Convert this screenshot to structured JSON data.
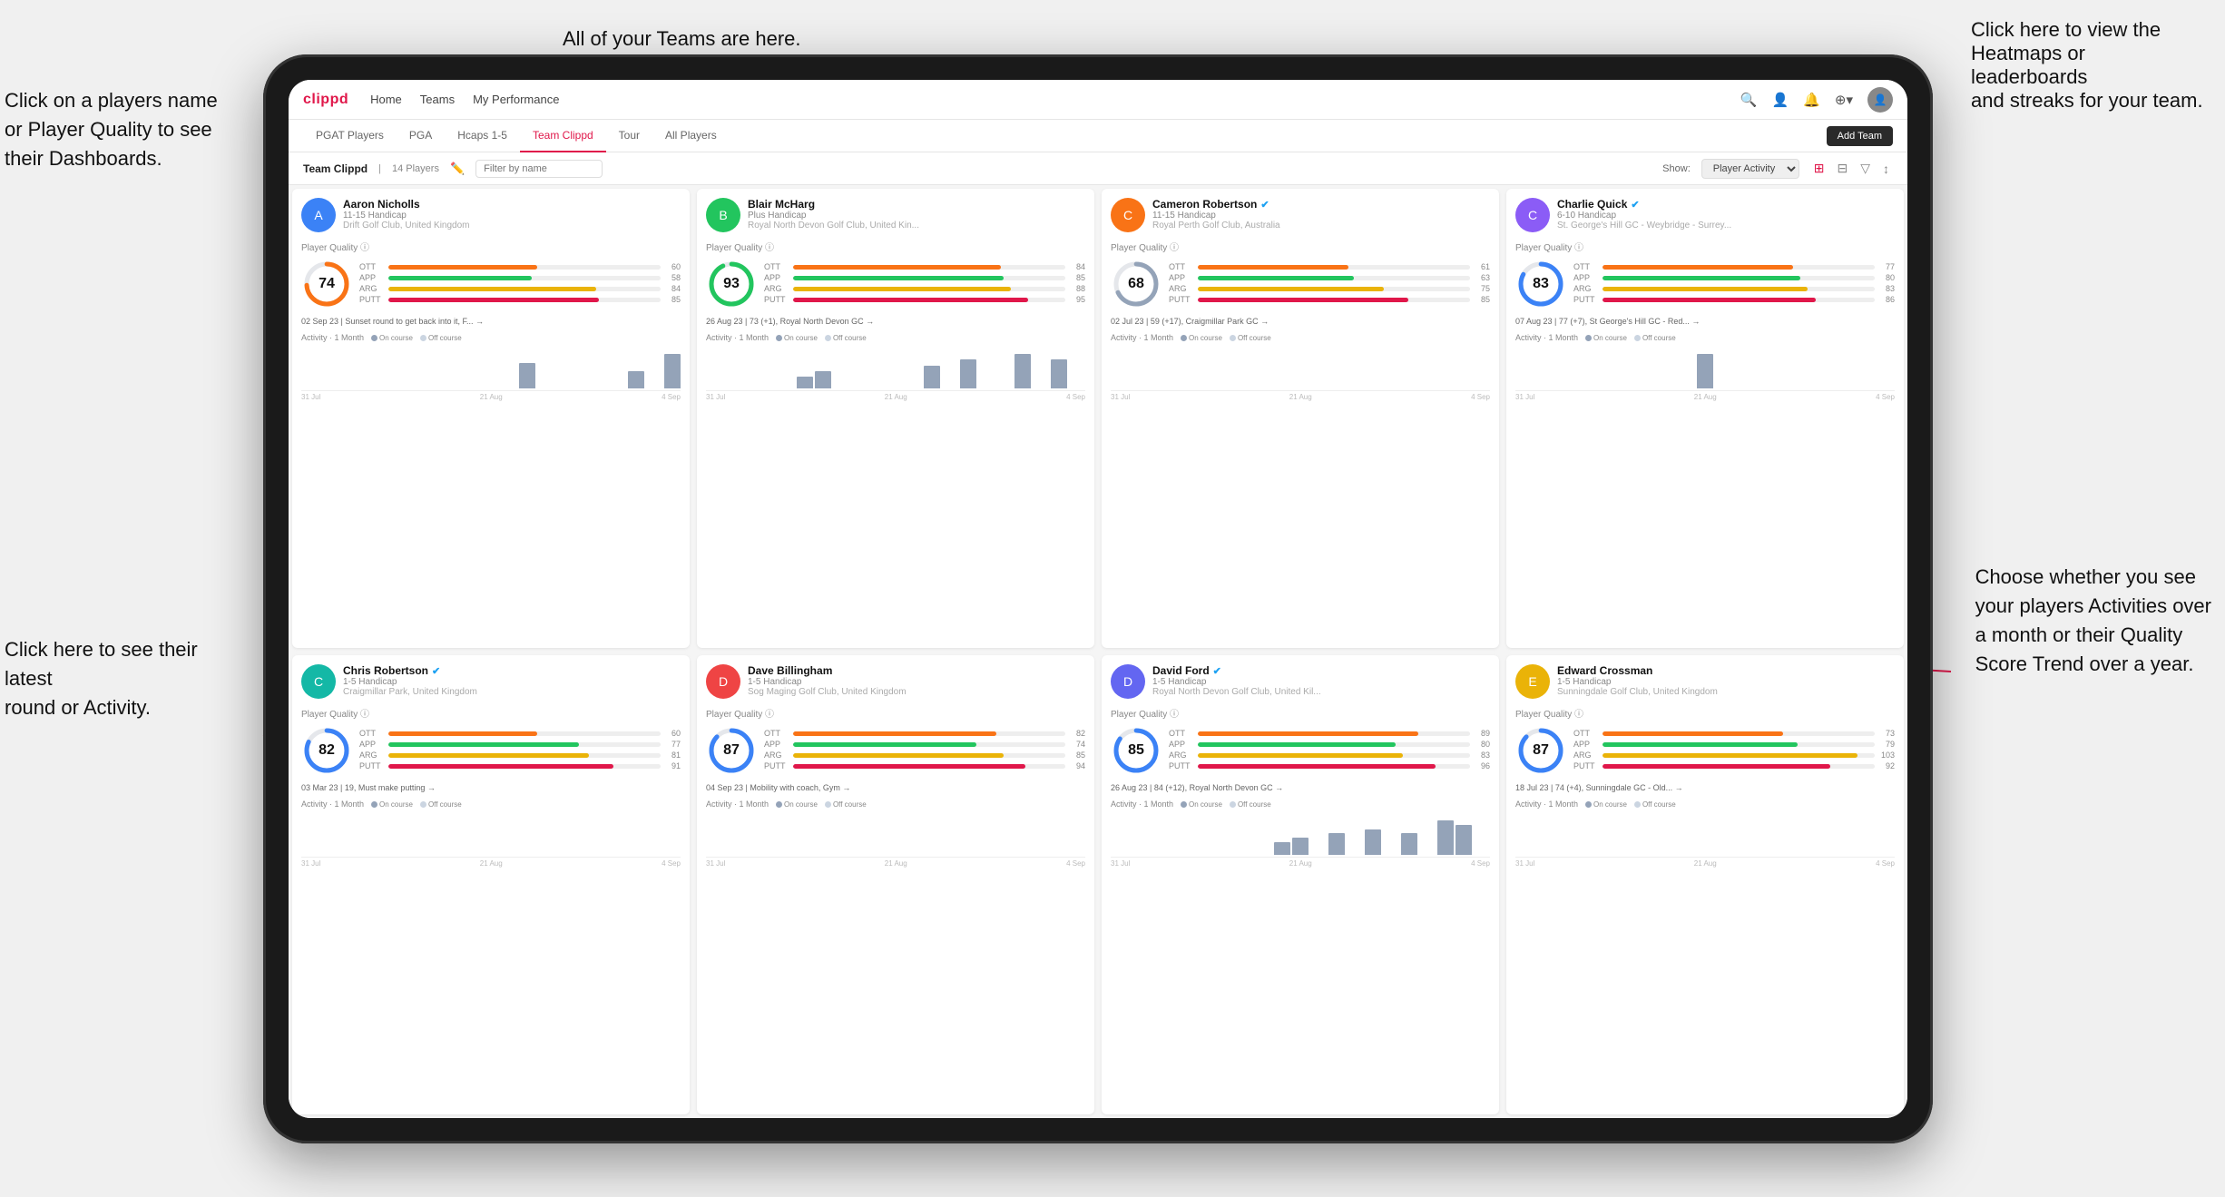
{
  "app": {
    "logo": "clippd",
    "nav": {
      "items": [
        "Home",
        "Teams",
        "My Performance"
      ],
      "icons": [
        "🔍",
        "👤",
        "🔔",
        "⊕"
      ],
      "avatar": "👤"
    },
    "sub_tabs": [
      "PGAT Players",
      "PGA",
      "Hcaps 1-5",
      "Team Clippd",
      "Tour",
      "All Players"
    ],
    "active_tab": "Team Clippd",
    "add_team_label": "Add Team",
    "team_title": "Team Clippd",
    "team_count": "14 Players",
    "filter_placeholder": "Filter by name",
    "show_label": "Show:",
    "show_value": "Player Activity",
    "view_icons": [
      "grid2",
      "grid3",
      "filter",
      "sort"
    ]
  },
  "annotations": {
    "top_center": "All of your Teams are here.",
    "top_right": "Click here to view the\nHeatmaps or leaderboards\nand streaks for your team.",
    "left_top": "Click on a players name\nor Player Quality to see\ntheir Dashboards.",
    "left_bottom": "Click here to see their latest\nround or Activity.",
    "right_bottom": "Choose whether you see\nyour players Activities over\na month or their Quality\nScore Trend over a year."
  },
  "players": [
    {
      "name": "Aaron Nicholls",
      "handicap": "11-15 Handicap",
      "club": "Drift Golf Club, United Kingdom",
      "quality": 74,
      "ott": 60,
      "app": 58,
      "arg": 84,
      "putt": 85,
      "latest_round": "02 Sep 23 | Sunset round to get back into it, F... →",
      "chart_bars": [
        0,
        0,
        0,
        0,
        0,
        0,
        0,
        0,
        0,
        0,
        0,
        0,
        3,
        0,
        0,
        0,
        0,
        0,
        2,
        0,
        4
      ],
      "chart_dates": [
        "31 Jul",
        "21 Aug",
        "4 Sep"
      ],
      "avatar_color": "av-blue",
      "avatar_letter": "A"
    },
    {
      "name": "Blair McHarg",
      "handicap": "Plus Handicap",
      "club": "Royal North Devon Golf Club, United Kin...",
      "quality": 93,
      "ott": 84,
      "app": 85,
      "arg": 88,
      "putt": 95,
      "latest_round": "26 Aug 23 | 73 (+1), Royal North Devon GC →",
      "chart_bars": [
        0,
        0,
        0,
        0,
        0,
        2,
        3,
        0,
        0,
        0,
        0,
        0,
        4,
        0,
        5,
        0,
        0,
        6,
        0,
        5,
        0
      ],
      "chart_dates": [
        "31 Jul",
        "21 Aug",
        "4 Sep"
      ],
      "avatar_color": "av-green",
      "avatar_letter": "B"
    },
    {
      "name": "Cameron Robertson",
      "handicap": "11-15 Handicap",
      "club": "Royal Perth Golf Club, Australia",
      "quality": 68,
      "ott": 61,
      "app": 63,
      "arg": 75,
      "putt": 85,
      "latest_round": "02 Jul 23 | 59 (+17), Craigmillar Park GC →",
      "chart_bars": [
        0,
        0,
        0,
        0,
        0,
        0,
        0,
        0,
        0,
        0,
        0,
        0,
        0,
        0,
        0,
        0,
        0,
        0,
        0,
        0,
        0
      ],
      "chart_dates": [
        "31 Jul",
        "21 Aug",
        "4 Sep"
      ],
      "avatar_color": "av-orange",
      "avatar_letter": "C",
      "verified": true
    },
    {
      "name": "Charlie Quick",
      "handicap": "6-10 Handicap",
      "club": "St. George's Hill GC - Weybridge - Surrey...",
      "quality": 83,
      "ott": 77,
      "app": 80,
      "arg": 83,
      "putt": 86,
      "latest_round": "07 Aug 23 | 77 (+7), St George's Hill GC - Red... →",
      "chart_bars": [
        0,
        0,
        0,
        0,
        0,
        0,
        0,
        0,
        0,
        0,
        3,
        0,
        0,
        0,
        0,
        0,
        0,
        0,
        0,
        0,
        0
      ],
      "chart_dates": [
        "31 Jul",
        "21 Aug",
        "4 Sep"
      ],
      "avatar_color": "av-purple",
      "avatar_letter": "C",
      "verified": true
    },
    {
      "name": "Chris Robertson",
      "handicap": "1-5 Handicap",
      "club": "Craigmillar Park, United Kingdom",
      "quality": 82,
      "ott": 60,
      "app": 77,
      "arg": 81,
      "putt": 91,
      "latest_round": "03 Mar 23 | 19, Must make putting →",
      "chart_bars": [
        0,
        0,
        0,
        0,
        0,
        0,
        0,
        0,
        0,
        0,
        0,
        0,
        0,
        0,
        0,
        0,
        0,
        0,
        0,
        0,
        0
      ],
      "chart_dates": [
        "31 Jul",
        "21 Aug",
        "4 Sep"
      ],
      "avatar_color": "av-teal",
      "avatar_letter": "C",
      "verified": true
    },
    {
      "name": "Dave Billingham",
      "handicap": "1-5 Handicap",
      "club": "Sog Maging Golf Club, United Kingdom",
      "quality": 87,
      "ott": 82,
      "app": 74,
      "arg": 85,
      "putt": 94,
      "latest_round": "04 Sep 23 | Mobility with coach, Gym →",
      "chart_bars": [
        0,
        0,
        0,
        0,
        0,
        0,
        0,
        0,
        0,
        0,
        0,
        0,
        0,
        0,
        0,
        0,
        0,
        0,
        0,
        0,
        0
      ],
      "chart_dates": [
        "31 Jul",
        "21 Aug",
        "4 Sep"
      ],
      "avatar_color": "av-red",
      "avatar_letter": "D"
    },
    {
      "name": "David Ford",
      "handicap": "1-5 Handicap",
      "club": "Royal North Devon Golf Club, United Kil...",
      "quality": 85,
      "ott": 89,
      "app": 80,
      "arg": 83,
      "putt": 96,
      "latest_round": "26 Aug 23 | 84 (+12), Royal North Devon GC →",
      "chart_bars": [
        0,
        0,
        0,
        0,
        0,
        0,
        0,
        0,
        0,
        3,
        4,
        0,
        5,
        0,
        6,
        0,
        5,
        0,
        8,
        7,
        0
      ],
      "chart_dates": [
        "31 Jul",
        "21 Aug",
        "4 Sep"
      ],
      "avatar_color": "av-indigo",
      "avatar_letter": "D",
      "verified": true
    },
    {
      "name": "Edward Crossman",
      "handicap": "1-5 Handicap",
      "club": "Sunningdale Golf Club, United Kingdom",
      "quality": 87,
      "ott": 73,
      "app": 79,
      "arg": 103,
      "putt": 92,
      "latest_round": "18 Jul 23 | 74 (+4), Sunningdale GC - Old... →",
      "chart_bars": [
        0,
        0,
        0,
        0,
        0,
        0,
        0,
        0,
        0,
        0,
        0,
        0,
        0,
        0,
        0,
        0,
        0,
        0,
        0,
        0,
        0
      ],
      "chart_dates": [
        "31 Jul",
        "21 Aug",
        "4 Sep"
      ],
      "avatar_color": "av-yellow",
      "avatar_letter": "E"
    }
  ],
  "bar_colors": {
    "ott": "#f97316",
    "app": "#22c55e",
    "arg": "#eab308",
    "putt": "#e0174a"
  },
  "circle_colors": {
    "74": "#3b82f6",
    "93": "#22c55e",
    "68": "#3b82f6",
    "83": "#3b82f6",
    "82": "#22c55e",
    "87": "#22c55e",
    "85": "#22c55e"
  }
}
